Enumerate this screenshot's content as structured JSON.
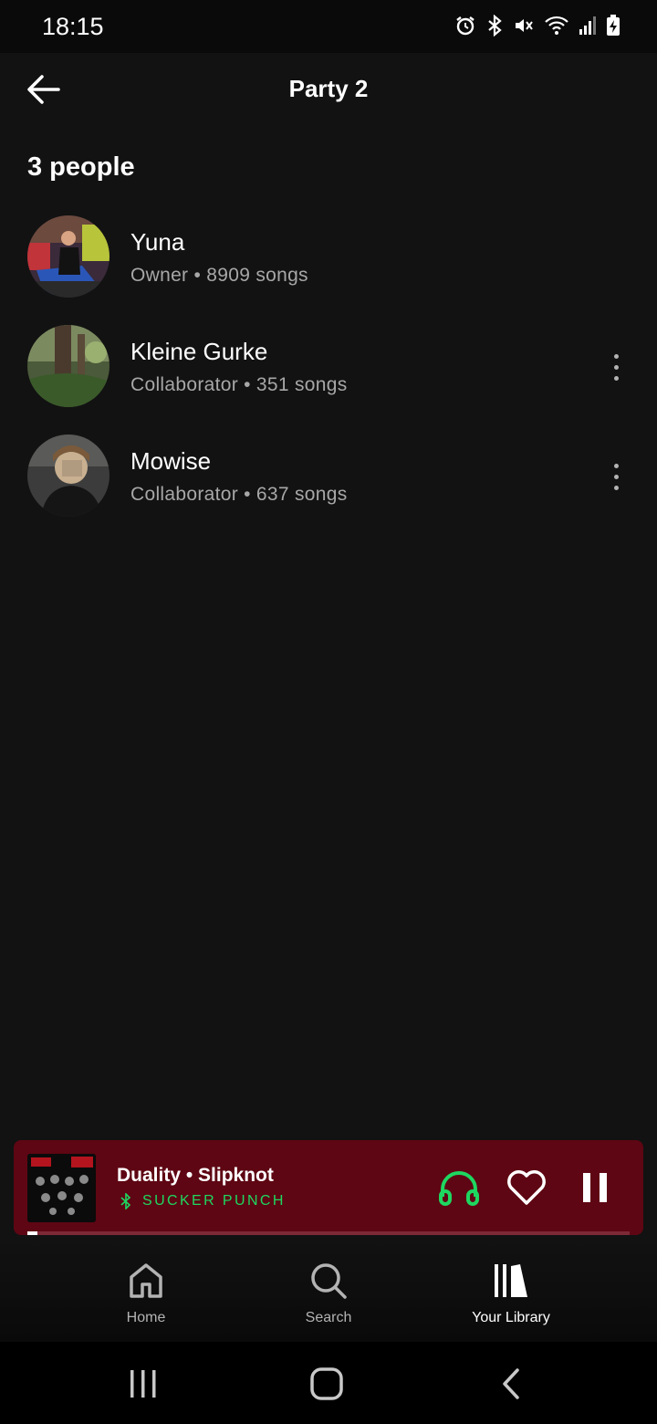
{
  "status_bar": {
    "time": "18:15",
    "icons": [
      "alarm-icon",
      "bluetooth-icon",
      "mute-icon",
      "wifi-icon",
      "signal-icon",
      "battery-charging-icon"
    ]
  },
  "header": {
    "title": "Party 2",
    "back_icon": "arrow-left-icon"
  },
  "people": {
    "count_label": "3 people",
    "members": [
      {
        "name": "Yuna",
        "meta": "Owner • 8909 songs",
        "has_menu": false
      },
      {
        "name": "Kleine Gurke",
        "meta": "Collaborator • 351 songs",
        "has_menu": true
      },
      {
        "name": "Mowise",
        "meta": "Collaborator • 637 songs",
        "has_menu": true
      }
    ]
  },
  "now_playing": {
    "title": "Duality • Slipknot",
    "device": "SUCKER PUNCH",
    "progress": 0.017,
    "colors": {
      "background": "#5e0613",
      "device": "#1ed760"
    }
  },
  "bottom_nav": {
    "items": [
      {
        "label": "Home",
        "icon": "home-icon",
        "active": false
      },
      {
        "label": "Search",
        "icon": "search-icon",
        "active": false
      },
      {
        "label": "Your Library",
        "icon": "library-icon",
        "active": true
      }
    ]
  },
  "system_nav": [
    "recents-icon",
    "home-circle-icon",
    "back-chevron-icon"
  ],
  "colors": {
    "background": "#121212",
    "accent": "#1ed760",
    "secondary_text": "#a7a7a7"
  }
}
